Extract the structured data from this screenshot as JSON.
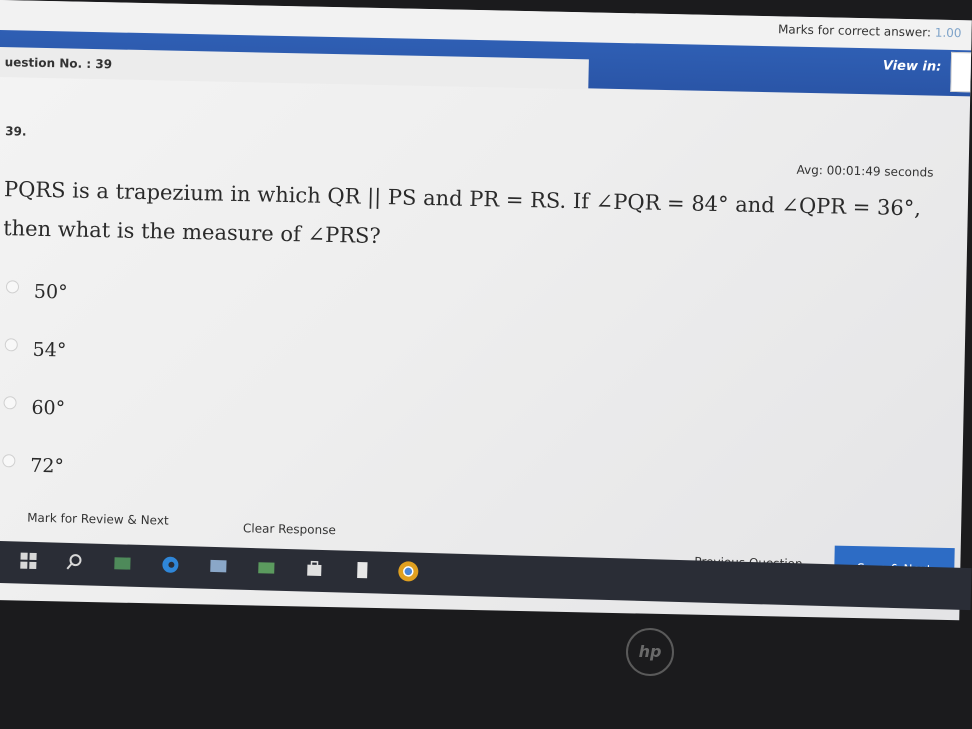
{
  "header": {
    "marks_label": "Marks for correct answer:",
    "marks_value": "1.00",
    "question_no": "uestion No. : 39",
    "view_in": "View in:"
  },
  "question": {
    "number": "39.",
    "avg_time": "Avg: 00:01:49 seconds",
    "line1": "PQRS is a trapezium in which QR || PS and PR = RS. If ∠PQR = 84° and ∠QPR = 36°,",
    "line2": "then what is the measure of ∠PRS?",
    "options": [
      "50°",
      "54°",
      "60°",
      "72°"
    ]
  },
  "actions": {
    "mark_review": "Mark for Review & Next",
    "clear": "Clear Response",
    "previous": "Previous Question",
    "save_next": "Save & Next"
  },
  "taskbar": {
    "icons": [
      "windows-start-icon",
      "search-icon",
      "task-view-icon",
      "edge-icon",
      "explorer-icon",
      "folder-icon",
      "store-icon",
      "bookmark-icon",
      "chrome-icon"
    ]
  },
  "colors": {
    "header_blue": "#2a55a7",
    "button_blue": "#2d6cc5",
    "taskbar": "#2a2d36"
  }
}
